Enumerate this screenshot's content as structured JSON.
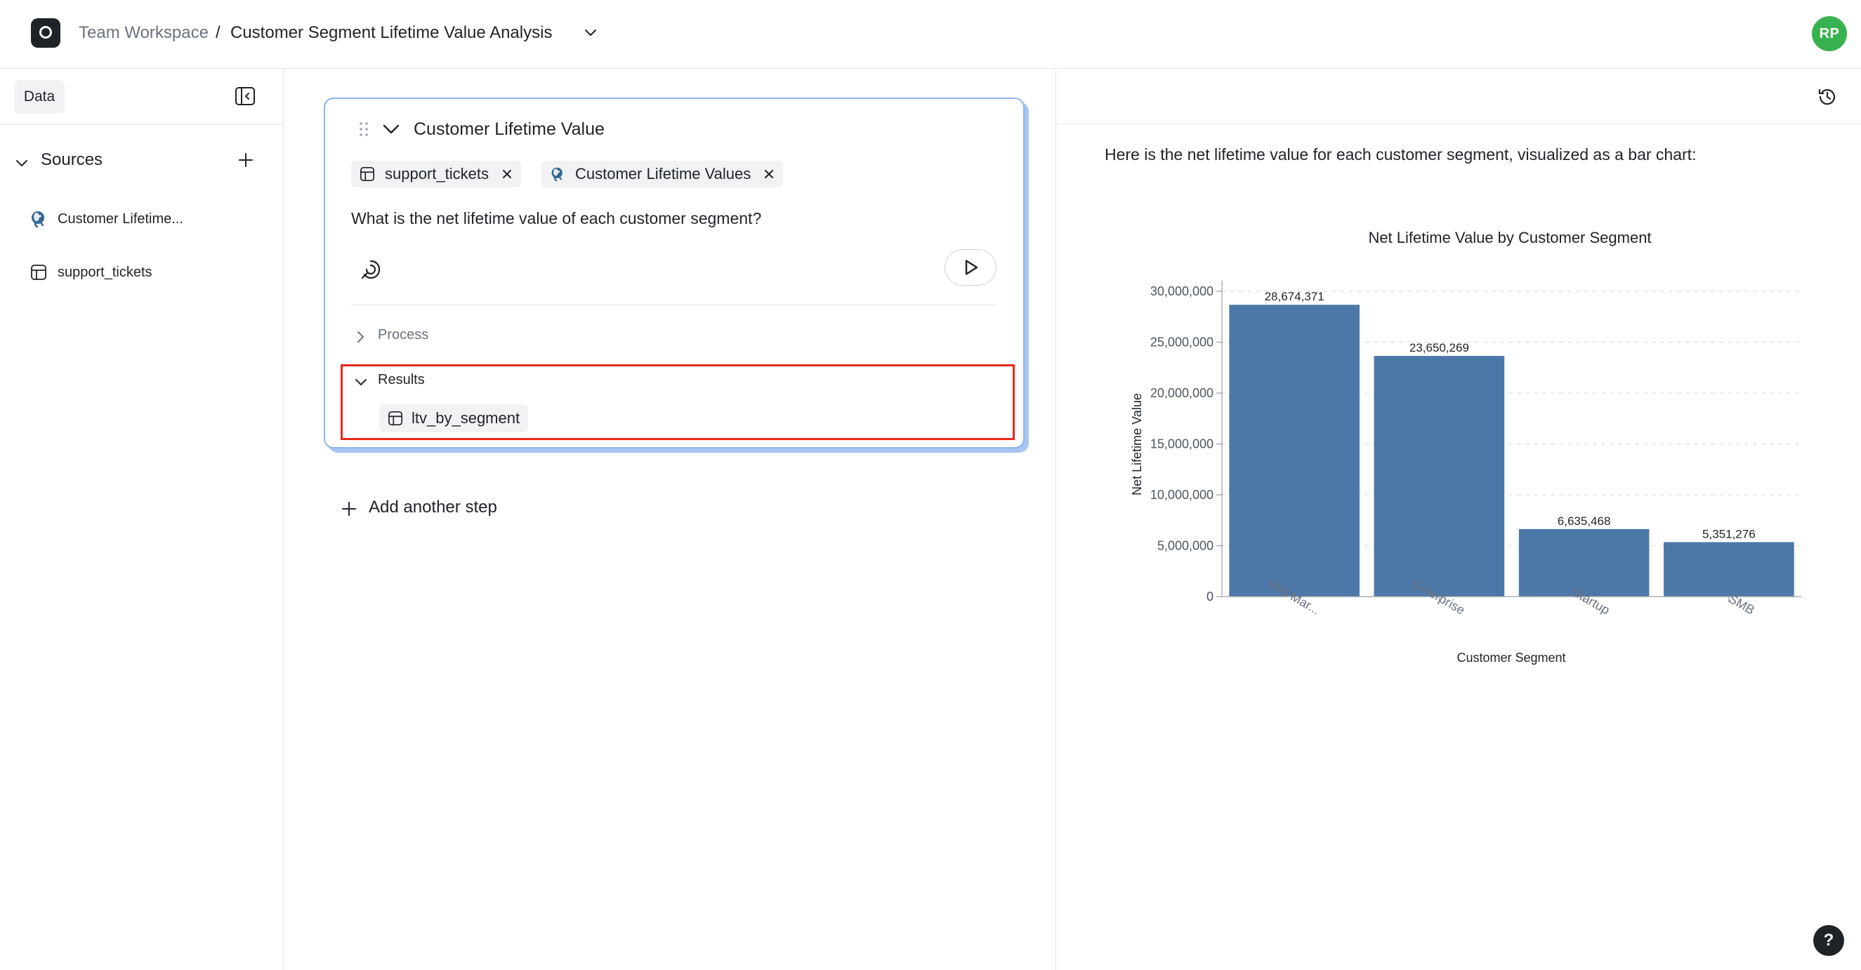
{
  "header": {
    "workspace": "Team Workspace",
    "separator": "/",
    "title": "Customer Segment Lifetime Value Analysis",
    "avatar_initials": "RP",
    "avatar_color": "#38b24f"
  },
  "sidebar": {
    "tab_label": "Data",
    "sources_label": "Sources",
    "items": [
      {
        "label": "Customer Lifetime...",
        "icon": "postgres-icon"
      },
      {
        "label": "support_tickets",
        "icon": "table-icon"
      }
    ]
  },
  "step": {
    "title": "Customer Lifetime Value",
    "chips": [
      {
        "label": "support_tickets",
        "icon": "table-icon"
      },
      {
        "label": "Customer Lifetime Values",
        "icon": "postgres-icon"
      }
    ],
    "question": "What is the net lifetime value of each customer segment?",
    "process_label": "Process",
    "results_label": "Results",
    "result_item": "ltv_by_segment"
  },
  "add_step_label": "Add another step",
  "answer": {
    "text": "Here is the net lifetime value for each customer segment, visualized as a bar chart:"
  },
  "help_label": "?",
  "colors": {
    "accent_border": "#8fb4ea",
    "highlight": "#e8291a",
    "bar": "#4c78a8"
  },
  "chart_data": {
    "type": "bar",
    "title": "Net Lifetime Value by Customer Segment",
    "xlabel": "Customer Segment",
    "ylabel": "Net Lifetime Value",
    "categories": [
      "Mid-Mar...",
      "Enterprise",
      "Startup",
      "SMB"
    ],
    "values": [
      28674371,
      23650269,
      6635468,
      5351276
    ],
    "value_labels": [
      "28,674,371",
      "23,650,269",
      "6,635,468",
      "5,351,276"
    ],
    "ylim": [
      0,
      30000000
    ],
    "yticks": [
      0,
      5000000,
      10000000,
      15000000,
      20000000,
      25000000,
      30000000
    ],
    "ytick_labels": [
      "0",
      "5,000,000",
      "10,000,000",
      "15,000,000",
      "20,000,000",
      "25,000,000",
      "30,000,000"
    ],
    "grid": true,
    "color": "#4c78a8"
  }
}
